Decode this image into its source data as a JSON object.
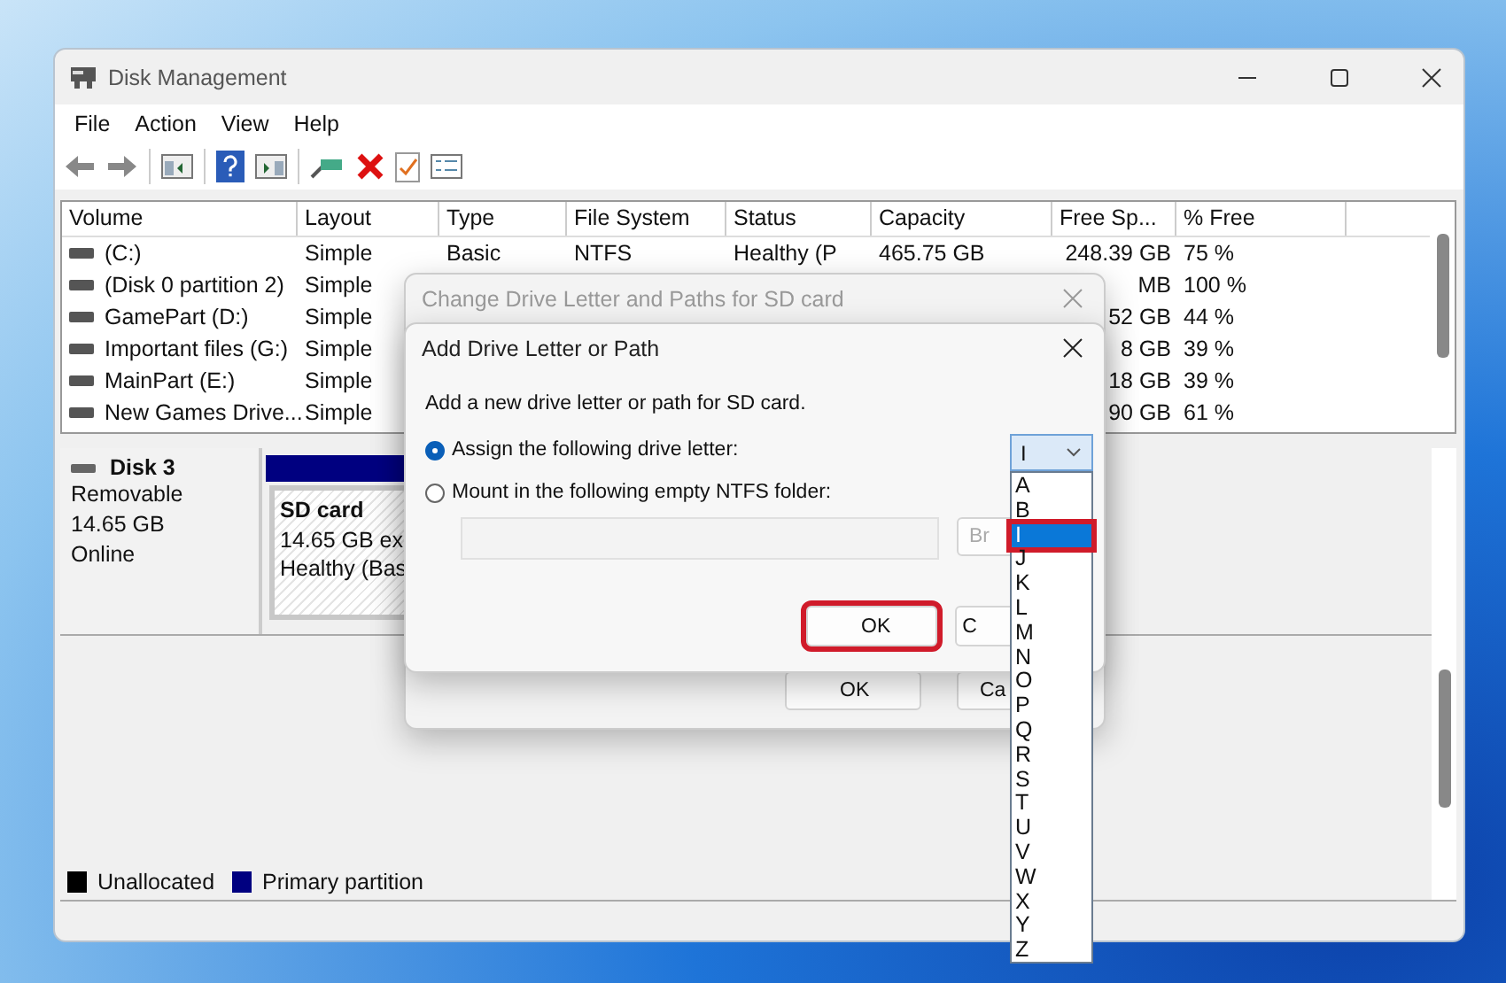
{
  "window": {
    "title": "Disk Management"
  },
  "menu": [
    "File",
    "Action",
    "View",
    "Help"
  ],
  "volume_table": {
    "columns": [
      "Volume",
      "Layout",
      "Type",
      "File System",
      "Status",
      "Capacity",
      "Free Sp...",
      "% Free"
    ],
    "rows": [
      {
        "volume": "(C:)",
        "layout": "Simple",
        "type": "Basic",
        "file_system": "NTFS",
        "status": "Healthy (P",
        "capacity": "465.75 GB",
        "free_space": "248.39 GB",
        "percent_free": "75 %"
      },
      {
        "volume": "(Disk 0 partition 2)",
        "layout": "Simple",
        "free_space": "MB",
        "percent_free": "100 %"
      },
      {
        "volume": "GamePart (D:)",
        "layout": "Simple",
        "free_space": "52 GB",
        "percent_free": "44 %"
      },
      {
        "volume": "Important files (G:)",
        "layout": "Simple",
        "free_space": "8 GB",
        "percent_free": "39 %"
      },
      {
        "volume": "MainPart (E:)",
        "layout": "Simple",
        "free_space": "18 GB",
        "percent_free": "39 %"
      },
      {
        "volume": "New Games Drive...",
        "layout": "Simple",
        "free_space": "90 GB",
        "percent_free": "61 %"
      }
    ]
  },
  "disk": {
    "name": "Disk 3",
    "type": "Removable",
    "size": "14.65 GB",
    "status": "Online",
    "partition": {
      "name": "SD card",
      "detail": "14.65 GB ex",
      "status": "Healthy (Bas"
    }
  },
  "legend": [
    {
      "label": "Unallocated",
      "color": "#000000"
    },
    {
      "label": "Primary partition",
      "color": "#000080"
    }
  ],
  "outer_dialog": {
    "title": "Change Drive Letter and Paths for SD card",
    "buttons": [
      "OK",
      "Ca"
    ]
  },
  "inner_dialog": {
    "title": "Add Drive Letter or Path",
    "description": "Add a new drive letter or path for SD card.",
    "options": [
      {
        "label": "Assign the following drive letter:",
        "selected": true
      },
      {
        "label": "Mount in the following empty NTFS folder:",
        "selected": false
      }
    ],
    "browse_button": "Br",
    "buttons": [
      {
        "label": "OK",
        "highlighted": true
      },
      {
        "label": "C",
        "highlighted": false
      }
    ],
    "drive_letter": {
      "value": "I",
      "options": [
        {
          "label": "A",
          "selected": false,
          "highlighted": false
        },
        {
          "label": "B",
          "selected": false,
          "highlighted": false
        },
        {
          "label": "I",
          "selected": true,
          "highlighted": true
        },
        {
          "label": "J",
          "selected": false,
          "highlighted": false
        },
        {
          "label": "K",
          "selected": false,
          "highlighted": false
        },
        {
          "label": "L",
          "selected": false,
          "highlighted": false
        },
        {
          "label": "M",
          "selected": false,
          "highlighted": false
        },
        {
          "label": "N",
          "selected": false,
          "highlighted": false
        },
        {
          "label": "O",
          "selected": false,
          "highlighted": false
        },
        {
          "label": "P",
          "selected": false,
          "highlighted": false
        },
        {
          "label": "Q",
          "selected": false,
          "highlighted": false
        },
        {
          "label": "R",
          "selected": false,
          "highlighted": false
        },
        {
          "label": "S",
          "selected": false,
          "highlighted": false
        },
        {
          "label": "T",
          "selected": false,
          "highlighted": false
        },
        {
          "label": "U",
          "selected": false,
          "highlighted": false
        },
        {
          "label": "V",
          "selected": false,
          "highlighted": false
        },
        {
          "label": "W",
          "selected": false,
          "highlighted": false
        },
        {
          "label": "X",
          "selected": false,
          "highlighted": false
        },
        {
          "label": "Y",
          "selected": false,
          "highlighted": false
        },
        {
          "label": "Z",
          "selected": false,
          "highlighted": false
        }
      ]
    }
  }
}
